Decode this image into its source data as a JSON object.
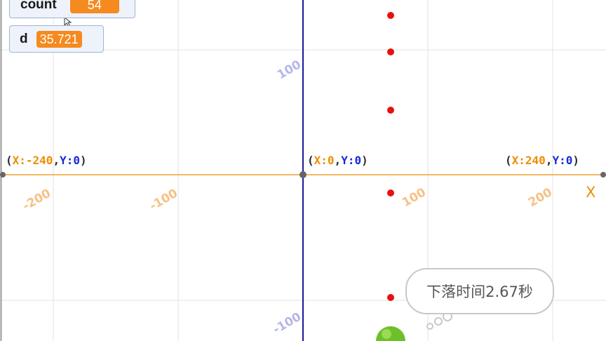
{
  "monitors": {
    "count": {
      "name": "count",
      "value": "54"
    },
    "d": {
      "name": "d",
      "value": "35.721"
    }
  },
  "axis": {
    "x_name": "X",
    "coords": {
      "left": {
        "open": "(",
        "x_label": "X:",
        "x": "-240",
        "sep": ",",
        "y_label": "Y:",
        "y": "0",
        "close": ")"
      },
      "center": {
        "open": "(",
        "x_label": "X:",
        "x": "0",
        "sep": ",",
        "y_label": "Y:",
        "y": "0",
        "close": ")"
      },
      "right": {
        "open": "(",
        "x_label": "X:",
        "x": "240",
        "sep": ",",
        "y_label": "Y:",
        "y": "0",
        "close": ")"
      }
    },
    "x_ticks": [
      "-200",
      "-100",
      "100",
      "200"
    ],
    "y_ticks": [
      "100",
      "-100"
    ]
  },
  "speech_bubble": {
    "text": "下落时间2.67秒"
  },
  "sprites": {
    "red_dot_count": 5,
    "ball": "green-ball"
  },
  "colors": {
    "x_axis": "#f0a030",
    "y_axis": "#1a1a9a",
    "grid": "#e3e3e3",
    "dot": "#e81010",
    "ball": "#6cc02a",
    "monitor_value": "#f58a1f"
  }
}
